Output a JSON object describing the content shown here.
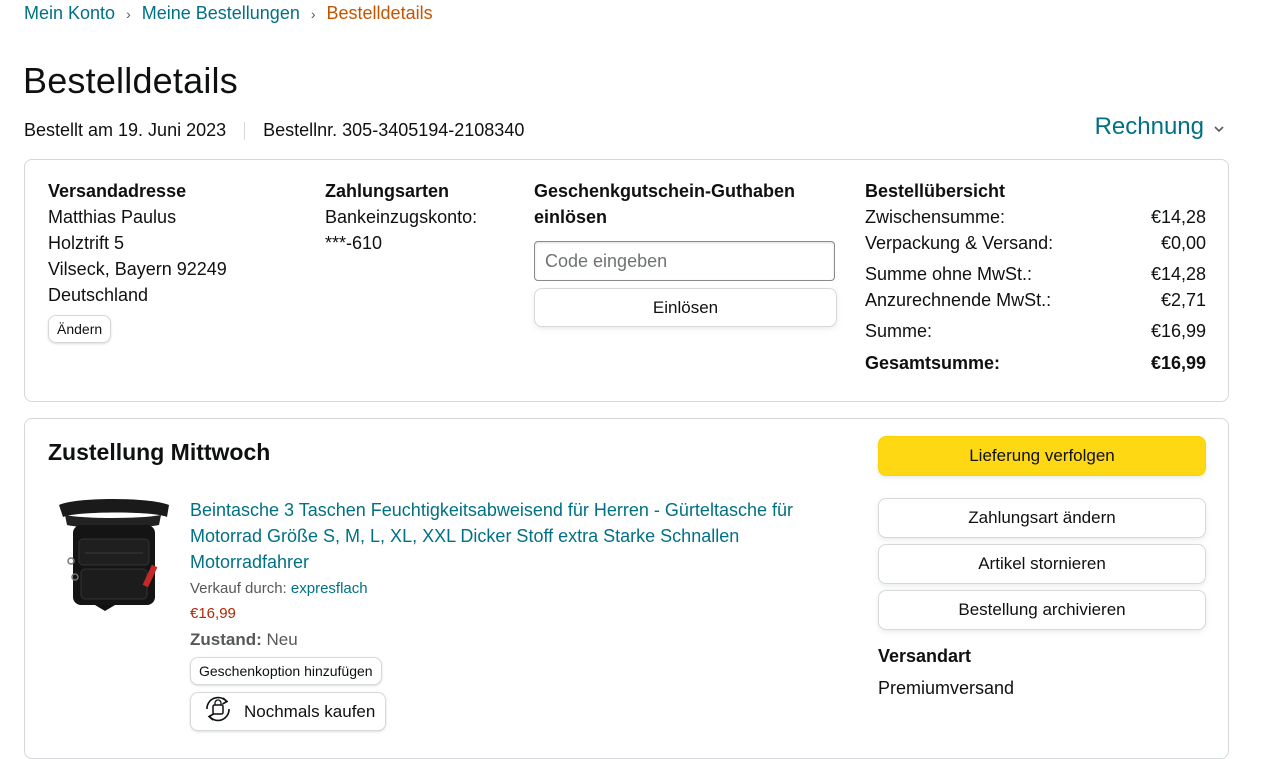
{
  "breadcrumb": {
    "items": [
      "Mein Konto",
      "Meine Bestellungen"
    ],
    "separator": "›",
    "current": "Bestelldetails"
  },
  "page": {
    "title": "Bestelldetails",
    "ordered_on": "Bestellt am 19. Juni 2023",
    "order_number": "Bestellnr. 305-3405194-2108340",
    "invoice_label": "Rechnung",
    "invoice_icon": "chevron-down-icon"
  },
  "address": {
    "title": "Versandadresse",
    "lines": [
      "Matthias Paulus",
      "Holztrift 5",
      "Vilseck, Bayern 92249",
      "Deutschland"
    ],
    "change_label": "Ändern"
  },
  "payment": {
    "title": "Zahlungsarten",
    "method": "Bankeinzugskonto:",
    "account": "***-610"
  },
  "gift": {
    "title": "Geschenkgutschein-Guthaben einlösen",
    "placeholder": "Code eingeben",
    "redeem_label": "Einlösen"
  },
  "summary": {
    "title": "Bestellübersicht",
    "rows": [
      {
        "label": "Zwischensumme:",
        "value": "€14,28"
      },
      {
        "label": "Verpackung & Versand:",
        "value": "€0,00"
      },
      {
        "label": "Summe ohne MwSt.:",
        "value": "€14,28"
      },
      {
        "label": "Anzurechnende MwSt.:",
        "value": "€2,71"
      },
      {
        "label": "Summe:",
        "value": "€16,99"
      }
    ],
    "total": {
      "label": "Gesamtsumme:",
      "value": "€16,99"
    }
  },
  "delivery": {
    "title": "Zustellung Mittwoch",
    "product": {
      "title": "Beintasche 3 Taschen Feuchtigkeitsabweisend für Herren - Gürteltasche für Motorrad Größe S, M, L, XL, XXL Dicker Stoff extra Starke Schnallen Motorradfahrer",
      "sold_by_label": "Verkauf durch: ",
      "seller": "expresflach",
      "price": "€16,99",
      "condition_label": "Zustand:",
      "condition_value": "Neu",
      "gift_option_label": "Geschenkoption hinzufügen",
      "buy_again_label": "Nochmals kaufen",
      "buy_again_icon": "buy-again-icon"
    },
    "actions": {
      "track": "Lieferung verfolgen",
      "change_payment": "Zahlungsart ändern",
      "cancel": "Artikel stornieren",
      "archive": "Bestellung archivieren"
    },
    "shipping": {
      "title": "Versandart",
      "value": "Premiumversand"
    }
  },
  "colors": {
    "link": "#007185",
    "current_breadcrumb": "#c45500",
    "price": "#b12704",
    "primary_button": "#ffd814"
  }
}
